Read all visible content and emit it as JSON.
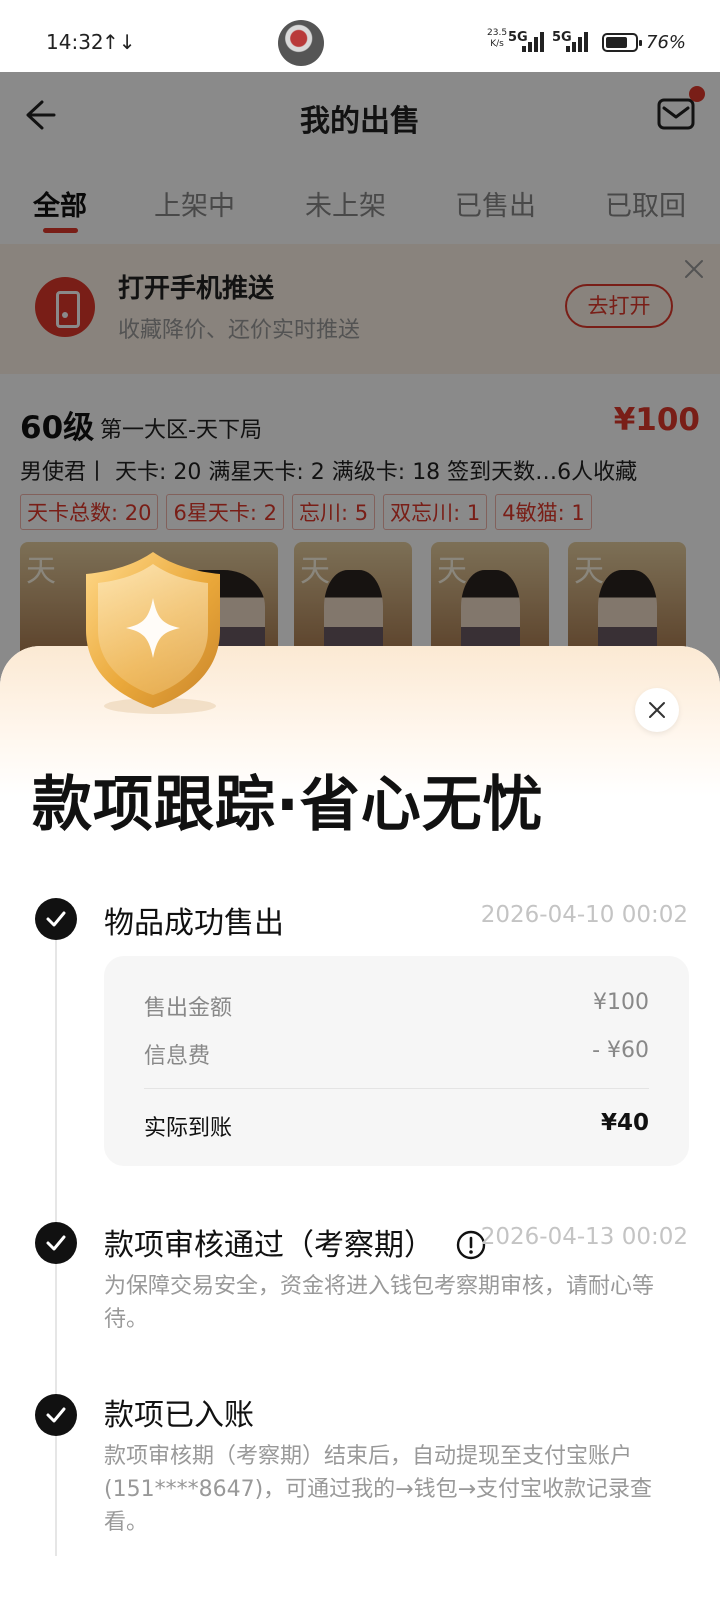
{
  "status_bar": {
    "time": "14:32",
    "data_arrows": "↑↓",
    "speed_value": "23.5",
    "speed_unit": "K/s",
    "network_1": "5G",
    "network_2": "5G",
    "battery_percent": "76%",
    "battery_level": 0.76
  },
  "header": {
    "title": "我的出售"
  },
  "tabs": [
    {
      "label": "全部",
      "active": true
    },
    {
      "label": "上架中",
      "active": false
    },
    {
      "label": "未上架",
      "active": false
    },
    {
      "label": "已售出",
      "active": false
    },
    {
      "label": "已取回",
      "active": false
    }
  ],
  "push_banner": {
    "title": "打开手机推送",
    "subtitle": "收藏降价、还价实时推送",
    "button": "去打开"
  },
  "listing": {
    "level": "60级",
    "server": "第一大区-天下局",
    "price": "¥100",
    "stats": "男使君丨 天卡: 20  满星天卡: 2  满级卡: 18  签到天数…6人收藏",
    "tags": [
      "天卡总数: 20",
      "6星天卡: 2",
      "忘川: 5",
      "双忘川: 1",
      "4敏猫: 1"
    ],
    "card_glyph": "天"
  },
  "sheet": {
    "title": "款项跟踪·省心无忧",
    "steps": [
      {
        "title": "物品成功售出",
        "time": "2026-04-10 00:02"
      },
      {
        "title": "款项审核通过（考察期）",
        "time": "2026-04-13 00:02",
        "desc": "为保障交易安全，资金将进入钱包考察期审核，请耐心等待。"
      },
      {
        "title": "款项已入账",
        "desc": "款项审核期（考察期）结束后，自动提现至支付宝账户(151****8647)，可通过我的→钱包→支付宝收款记录查看。"
      }
    ],
    "detail": {
      "sale_label": "售出金额",
      "sale_value": "¥100",
      "fee_label": "信息费",
      "fee_value": "- ¥60",
      "net_label": "实际到账",
      "net_value": "¥40"
    }
  },
  "colors": {
    "accent": "#e0392b",
    "banner_bg": "#fdf3e8",
    "sheet_gradient_top": "#fbe9d3",
    "shield_gold": "#e8a93c"
  }
}
